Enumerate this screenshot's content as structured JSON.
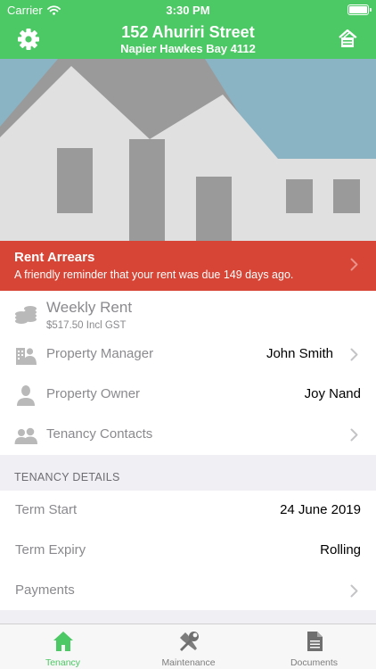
{
  "status_bar": {
    "carrier": "Carrier",
    "time": "3:30 PM"
  },
  "header": {
    "title": "152 Ahuriri Street",
    "subtitle": "Napier Hawkes Bay 4112"
  },
  "arrears": {
    "title": "Rent Arrears",
    "message": "A friendly reminder that your rent was due 149 days ago."
  },
  "rows": {
    "weekly_rent": {
      "label": "Weekly Rent",
      "sub": "$517.50 Incl GST"
    },
    "property_manager": {
      "label": "Property Manager",
      "value": "John Smith"
    },
    "property_owner": {
      "label": "Property Owner",
      "value": "Joy Nand"
    },
    "tenancy_contacts": {
      "label": "Tenancy Contacts"
    }
  },
  "tenancy_details": {
    "header": "TENANCY DETAILS",
    "term_start": {
      "label": "Term Start",
      "value": "24 June 2019"
    },
    "term_expiry": {
      "label": "Term Expiry",
      "value": "Rolling"
    },
    "payments": {
      "label": "Payments"
    }
  },
  "tabs": [
    {
      "label": "Tenancy",
      "icon": "house-icon",
      "active": true
    },
    {
      "label": "Maintenance",
      "icon": "tools-icon",
      "active": false
    },
    {
      "label": "Documents",
      "icon": "document-icon",
      "active": false
    }
  ],
  "colors": {
    "accent": "#4cc864",
    "alert": "#d64535",
    "sky": "#8ab3c3"
  }
}
